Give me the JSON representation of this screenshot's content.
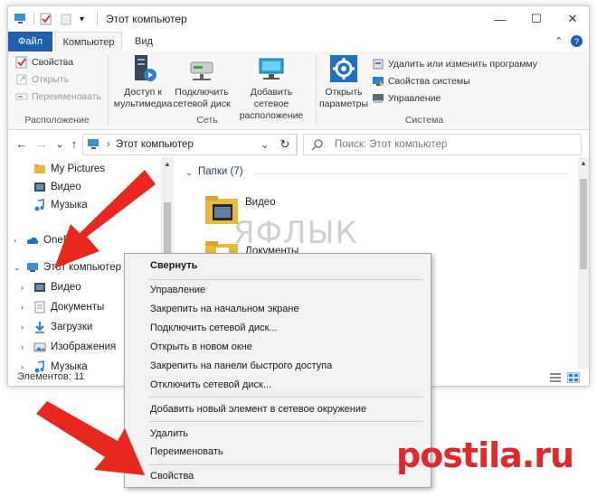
{
  "window": {
    "title": "Этот компьютер",
    "minimize_glyph": "—",
    "maximize_glyph": "☐",
    "close_glyph": "✕"
  },
  "tabs": {
    "file": "Файл",
    "computer": "Компьютер",
    "view": "Вид",
    "collapse_glyph": "⌃",
    "help_glyph": "?"
  },
  "ribbon": {
    "location": {
      "label": "Расположение",
      "properties": "Свойства",
      "open": "Открыть",
      "rename": "Переименовать"
    },
    "network": {
      "label": "Сеть",
      "media_access": "Доступ к\nмультимедиа",
      "map_drive": "Подключить\nсетевой диск",
      "add_location": "Добавить сетевое\nрасположение"
    },
    "system": {
      "label": "Система",
      "open_settings": "Открыть\nпараметры",
      "uninstall": "Удалить или изменить программу",
      "system_properties": "Свойства системы",
      "manage": "Управление"
    }
  },
  "navbar": {
    "back_glyph": "←",
    "forward_glyph": "→",
    "dropdown_glyph": "⌄",
    "up_glyph": "↑",
    "path_sep": "›",
    "address": "Этот компьютер",
    "refresh_glyph": "↻",
    "search_placeholder": "Поиск: Этот компьютер"
  },
  "nav_pane": {
    "items": [
      {
        "label": "My Pictures",
        "icon": "folder-icon"
      },
      {
        "label": "Видео",
        "icon": "video-folder-icon"
      },
      {
        "label": "Музыка",
        "icon": "music-icon"
      },
      {
        "label": "OneDrive",
        "icon": "cloud-icon"
      },
      {
        "label": "Этот компьютер",
        "icon": "computer-icon"
      },
      {
        "label": "Видео",
        "icon": "video-folder-icon"
      },
      {
        "label": "Документы",
        "icon": "documents-icon"
      },
      {
        "label": "Загрузки",
        "icon": "downloads-icon"
      },
      {
        "label": "Изображения",
        "icon": "pictures-icon"
      },
      {
        "label": "Музыка",
        "icon": "music-icon"
      }
    ]
  },
  "content": {
    "section": "Папки (7)",
    "folders": [
      {
        "label": "Видео"
      },
      {
        "label": "Документы"
      }
    ]
  },
  "status": {
    "items_count": "Элементов: 11"
  },
  "context_menu": {
    "items": [
      {
        "label": "Свернуть",
        "bold": true
      },
      {
        "label": "Управление"
      },
      {
        "label": "Закрепить на начальном экране"
      },
      {
        "label": "Подключить сетевой диск..."
      },
      {
        "label": "Открыть в новом окне"
      },
      {
        "label": "Закрепить на панели быстрого доступа"
      },
      {
        "label": "Отключить сетевой диск..."
      },
      {
        "label": "Добавить новый элемент в сетевое окружение"
      },
      {
        "label": "Удалить"
      },
      {
        "label": "Переименовать"
      },
      {
        "label": "Свойства"
      }
    ]
  },
  "watermarks": {
    "top": "ЯФЛЫК",
    "bottom": "postila.ru"
  },
  "colors": {
    "accent": "#1d5fb0",
    "arrow": "#e8281e",
    "folder": "#e8b93c"
  }
}
